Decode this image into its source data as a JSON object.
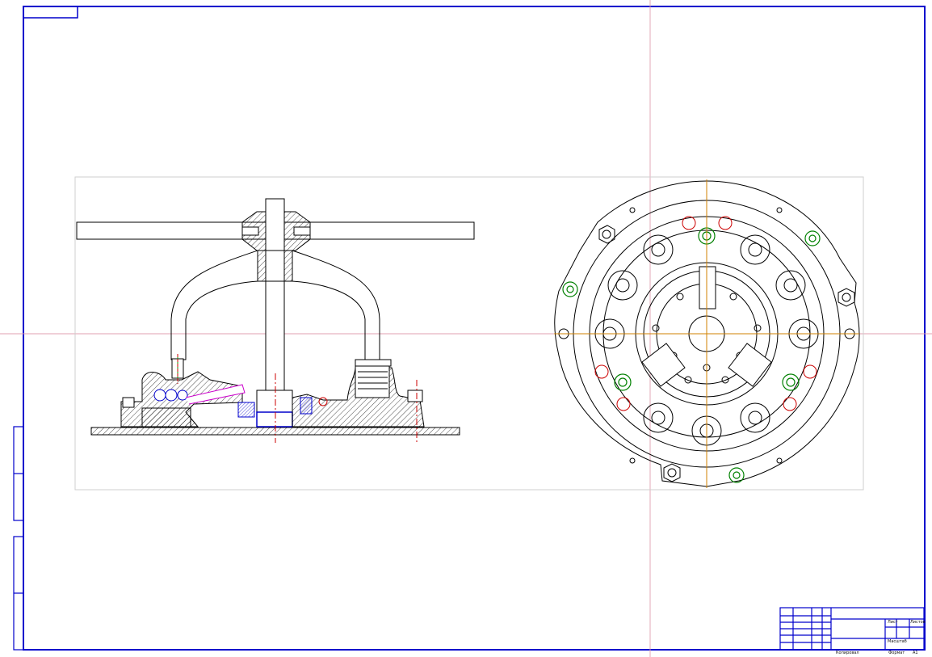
{
  "drawing": {
    "views": [
      "section-view",
      "plan-view"
    ]
  },
  "colors": {
    "frame": "#0000cc",
    "geometry": "#000000",
    "center_line": "#e0a0b0",
    "axis_line": "#d08000",
    "hidden_red": "#cc0000",
    "green_fastener": "#008000",
    "magenta_part": "#cc00cc",
    "view_border": "#cfcfcf"
  },
  "title_block": {
    "small_labels": [
      "Лист",
      "Листов",
      "Масштаб",
      "Копировал",
      "Формат",
      "А1"
    ]
  }
}
